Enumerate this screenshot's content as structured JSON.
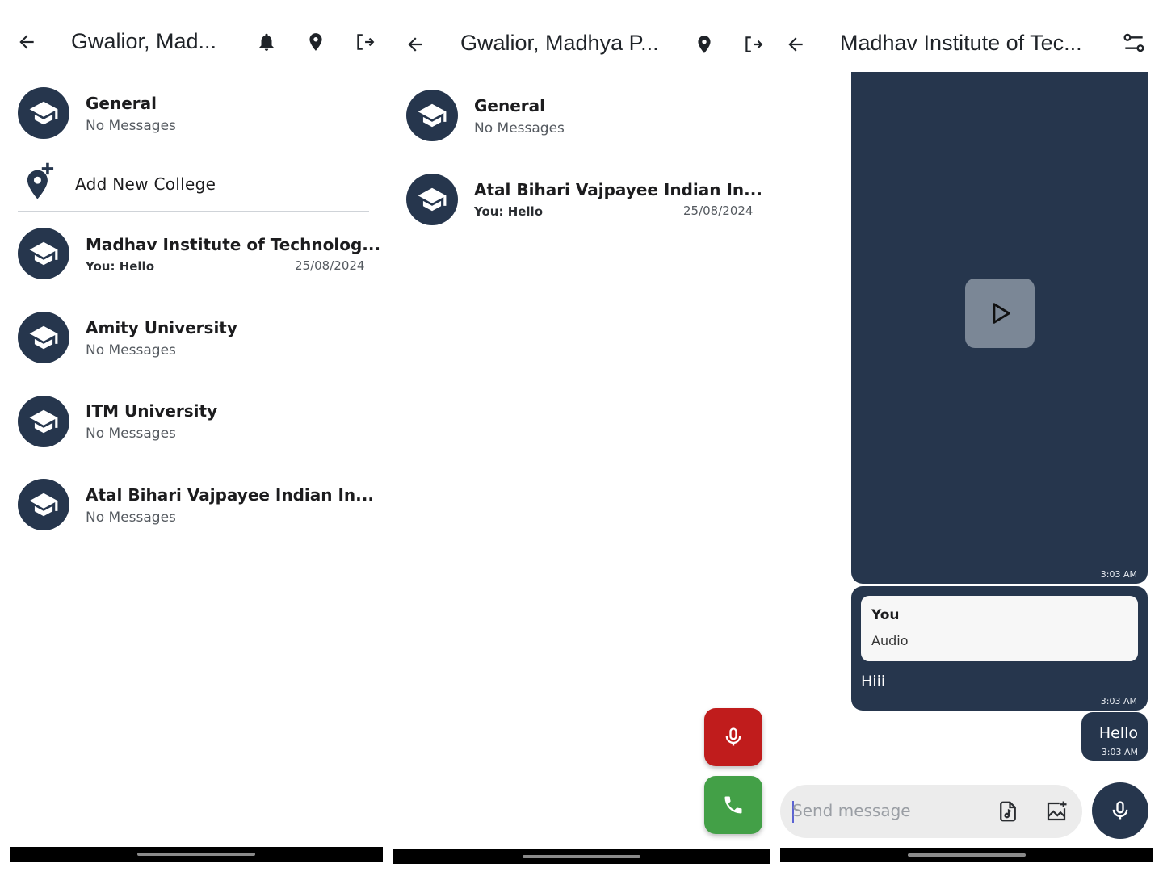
{
  "screen1": {
    "header": {
      "title": "Gwalior, Mad..."
    },
    "general": {
      "name": "General",
      "subtitle": "No Messages"
    },
    "add_college_label": "Add New College",
    "colleges": [
      {
        "name": "Madhav Institute of Technolog...",
        "subtitle": "You: Hello",
        "date": "25/08/2024"
      },
      {
        "name": "Amity University",
        "subtitle": "No Messages",
        "date": ""
      },
      {
        "name": "ITM University",
        "subtitle": "No Messages",
        "date": ""
      },
      {
        "name": "Atal Bihari Vajpayee Indian In...",
        "subtitle": "No Messages",
        "date": ""
      }
    ]
  },
  "screen2": {
    "header": {
      "title": "Gwalior, Madhya P..."
    },
    "general": {
      "name": "General",
      "subtitle": "No Messages"
    },
    "colleges": [
      {
        "name": "Atal Bihari Vajpayee Indian In...",
        "subtitle": "You: Hello",
        "date": "25/08/2024"
      }
    ]
  },
  "screen3": {
    "header": {
      "title": "Madhav Institute of Tec..."
    },
    "messages": {
      "video_time": "3:03 AM",
      "reply_sender": "You",
      "reply_type": "Audio",
      "reply_text": "Hiii",
      "reply_time": "3:03 AM",
      "hello_text": "Hello",
      "hello_time": "3:03 AM"
    },
    "composer": {
      "placeholder": "Send message"
    }
  },
  "colors": {
    "primary": "#26364d",
    "record_red": "#c01c1c",
    "call_green": "#43a047",
    "composer_bg": "#ececec"
  },
  "icons": [
    "back-arrow-icon",
    "bell-icon",
    "location-pin-icon",
    "logout-icon",
    "graduation-cap-icon",
    "add-location-icon",
    "mic-icon",
    "phone-icon",
    "play-icon",
    "filter-settings-icon",
    "audio-file-icon",
    "add-image-icon"
  ]
}
